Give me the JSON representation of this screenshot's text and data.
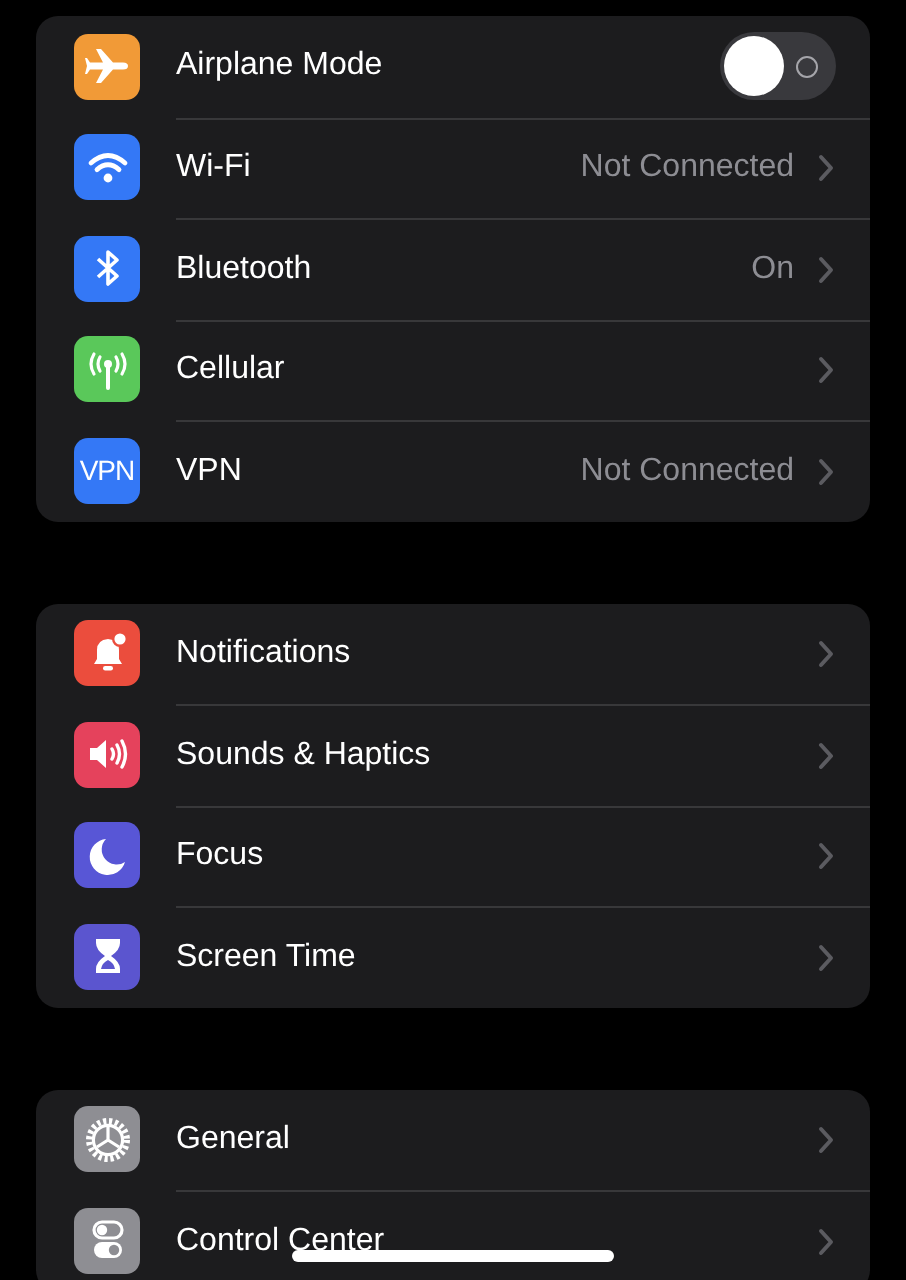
{
  "groups": [
    {
      "rows": [
        {
          "label": "Airplane Mode",
          "color": "#f19a37",
          "kind": "toggle",
          "on": false
        },
        {
          "label": "Wi-Fi",
          "color": "#3478f6",
          "kind": "link",
          "value": "Not Connected"
        },
        {
          "label": "Bluetooth",
          "color": "#3478f6",
          "kind": "link",
          "value": "On"
        },
        {
          "label": "Cellular",
          "color": "#5ac85a",
          "kind": "link"
        },
        {
          "label": "VPN",
          "color": "#3478f6",
          "kind": "link",
          "icon_text": "VPN",
          "value": "Not Connected"
        }
      ]
    },
    {
      "rows": [
        {
          "label": "Notifications",
          "color": "#eb4d3d",
          "kind": "link"
        },
        {
          "label": "Sounds & Haptics",
          "color": "#e5425c",
          "kind": "link"
        },
        {
          "label": "Focus",
          "color": "#5856d6",
          "kind": "link"
        },
        {
          "label": "Screen Time",
          "color": "#5b55cf",
          "kind": "link"
        }
      ]
    },
    {
      "rows": [
        {
          "label": "General",
          "color": "#8e8e93",
          "kind": "link"
        },
        {
          "label": "Control Center",
          "color": "#8e8e93",
          "kind": "link"
        }
      ]
    }
  ]
}
